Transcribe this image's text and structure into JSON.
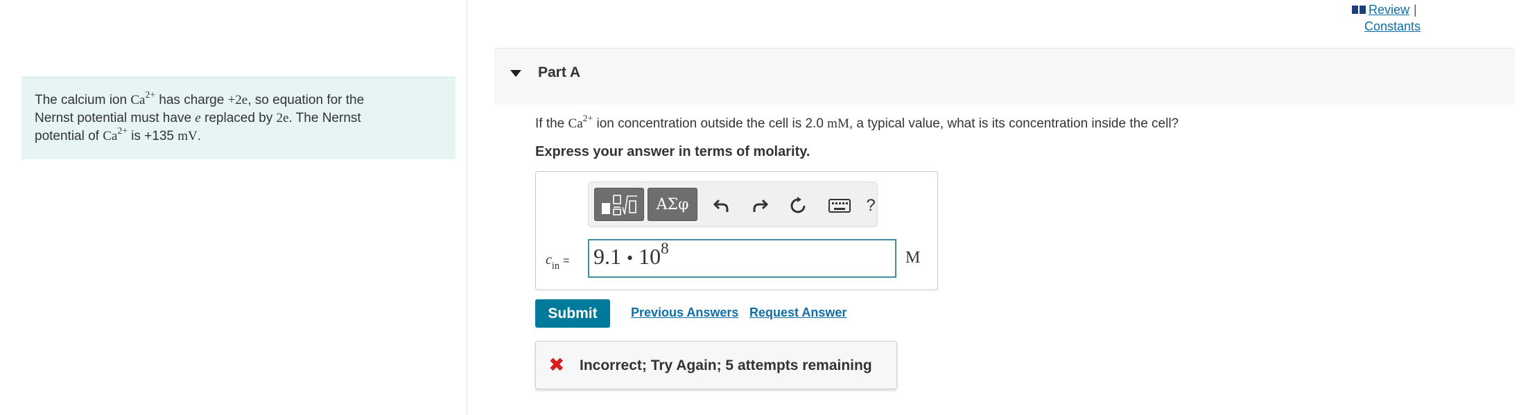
{
  "header": {
    "review_link": "Review",
    "separator": "|",
    "constants_link": "Constants"
  },
  "hint": {
    "line1": {
      "a": "The calcium ion ",
      "ion": "Ca",
      "charge_sup": "2+",
      "b": " has charge ",
      "charge": "+2e",
      "c": ", so equation for the"
    },
    "line2": {
      "a": "Nernst potential must have ",
      "e": "e",
      "b": " replaced by ",
      "two_e": "2e",
      "c": ". The Nernst"
    },
    "line3": {
      "a": "potential of ",
      "ion": "Ca",
      "charge_sup": "2+",
      "b": " is +135 ",
      "unit": "mV",
      "c": "."
    }
  },
  "part": {
    "title": "Part A"
  },
  "question": {
    "a": "If the ",
    "ion": "Ca",
    "charge_sup": "2+",
    "b": " ion concentration outside the cell is 2.0 ",
    "unit": "mM",
    "c": ", a typical value, what is its concentration inside the cell?"
  },
  "instruction": "Express your answer in terms of molarity.",
  "toolbar": {
    "greek_label": "ΑΣφ",
    "help_label": "?",
    "icons": [
      "templates-icon",
      "undo-icon",
      "redo-icon",
      "reset-icon",
      "keyboard-icon"
    ]
  },
  "answer": {
    "var": "c",
    "var_sub": "in",
    "equals": "=",
    "mantissa": "9.1",
    "dot": "•",
    "base": "10",
    "exponent": "8",
    "unit": "M"
  },
  "actions": {
    "submit": "Submit",
    "previous_answers": "Previous Answers",
    "request_answer": "Request Answer"
  },
  "feedback": {
    "icon": "✖",
    "text": "Incorrect; Try Again; 5 attempts remaining"
  },
  "colors": {
    "accent": "#007a9b",
    "link": "#0f6ea6",
    "error": "#d81e1e",
    "hint_bg": "#e6f4f4"
  }
}
